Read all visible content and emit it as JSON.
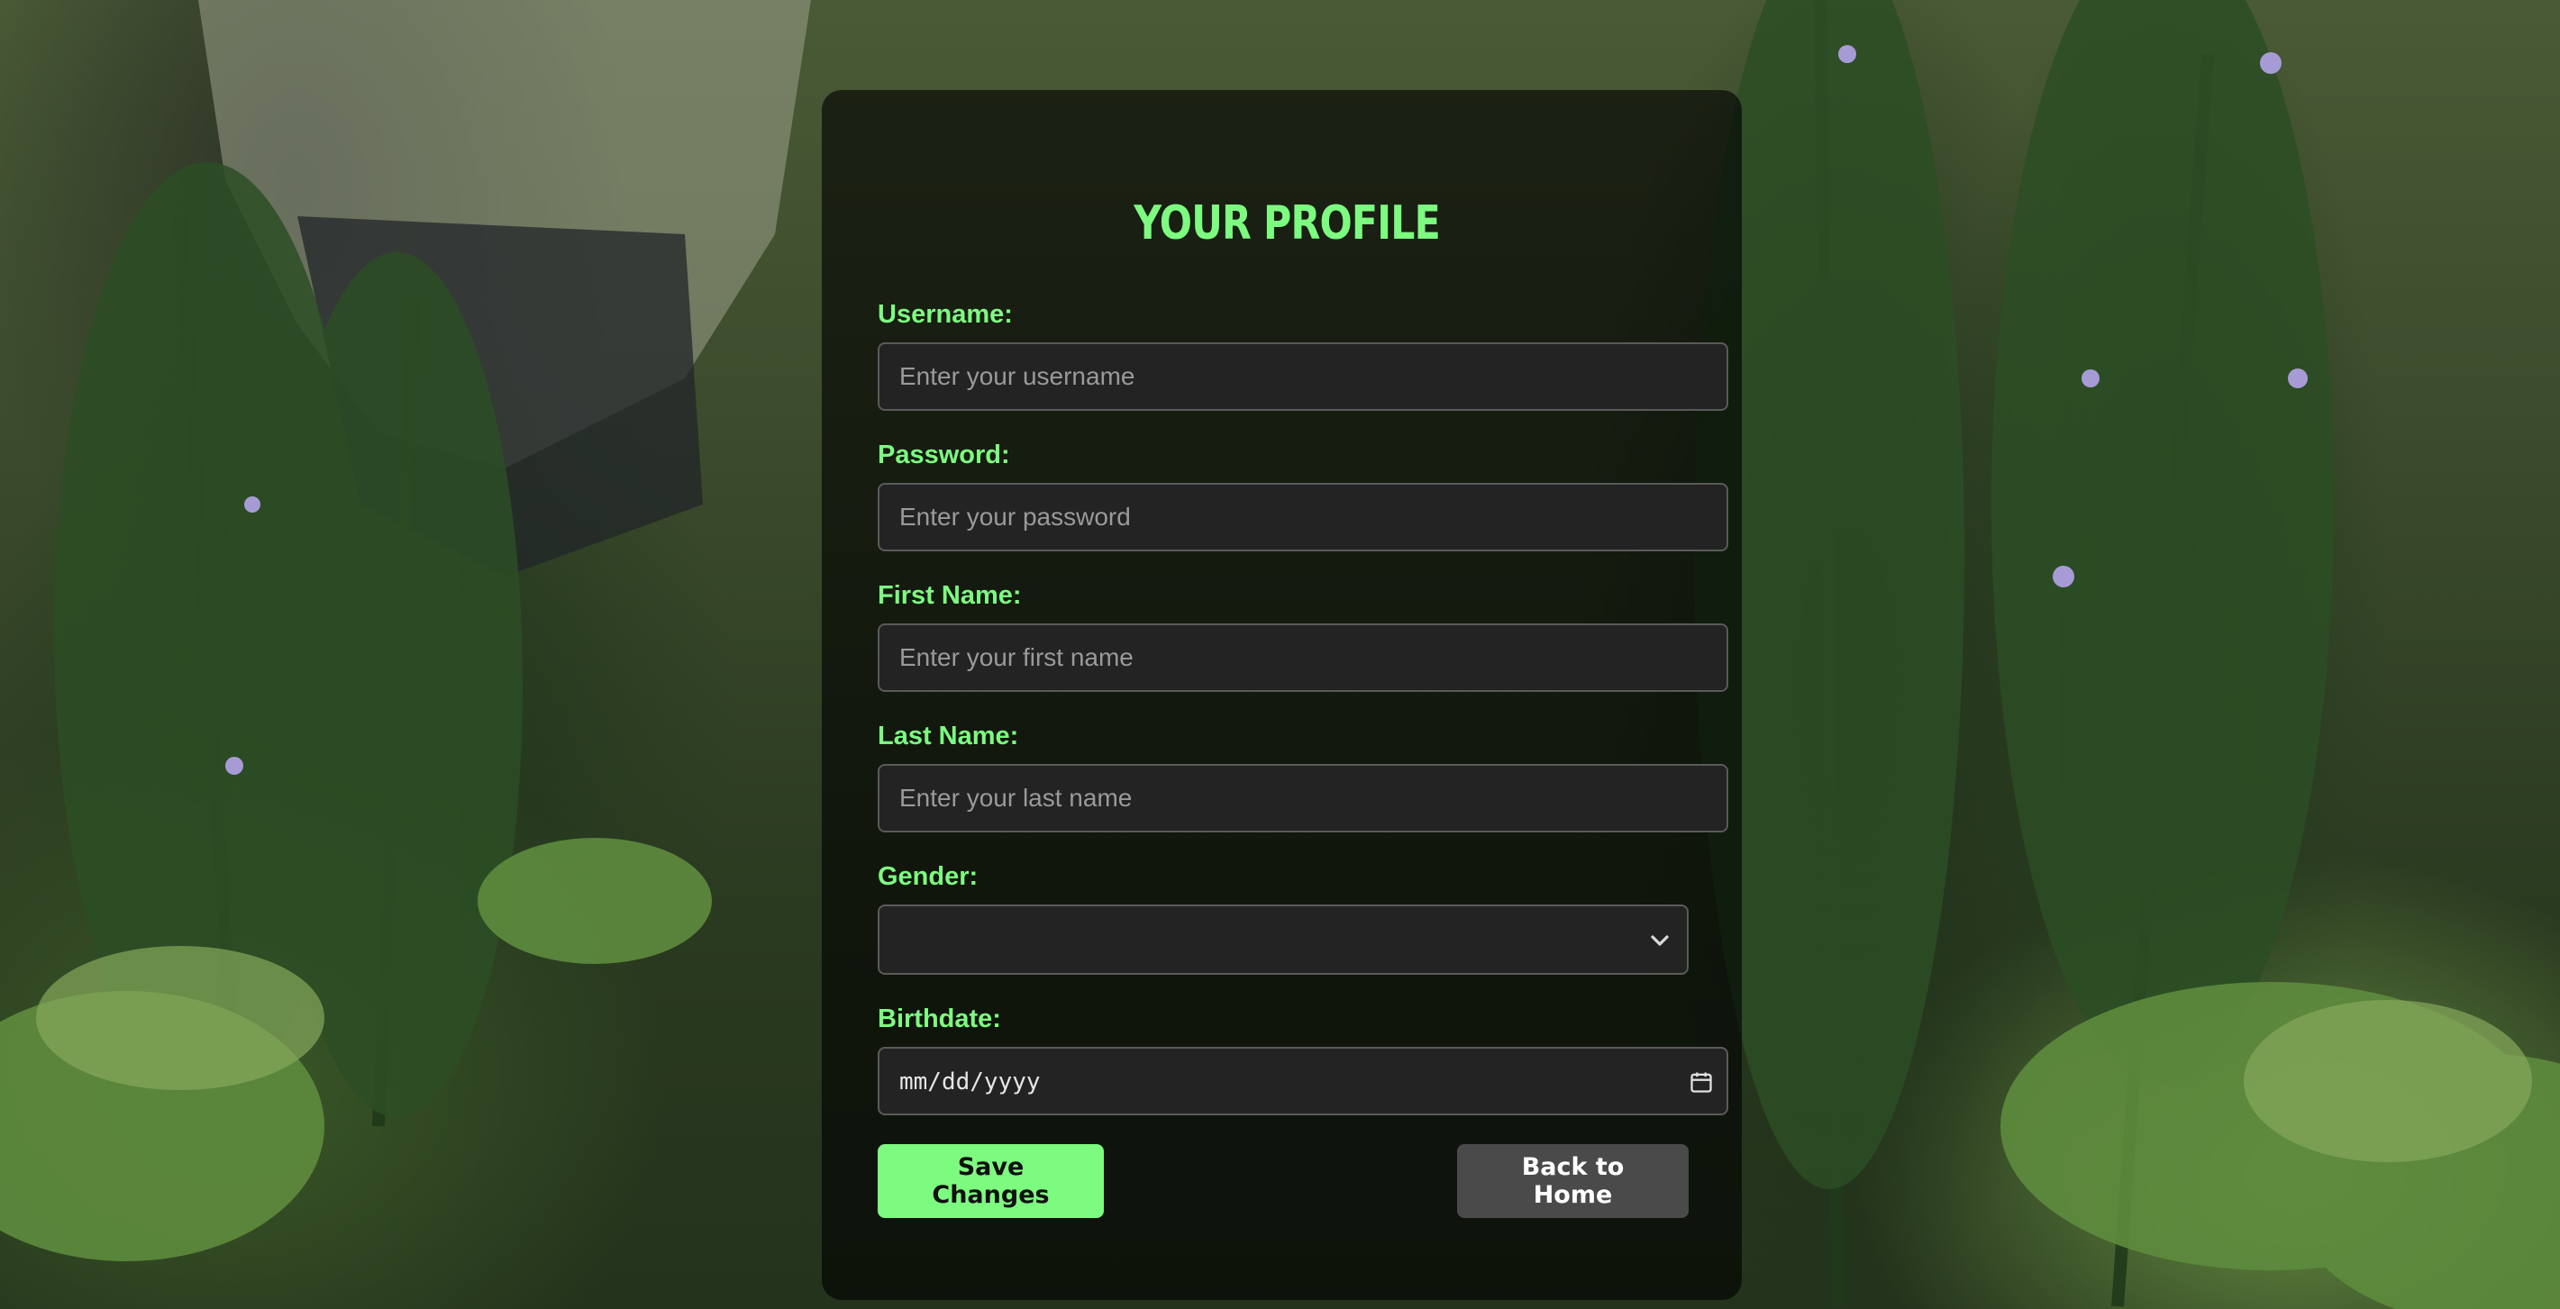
{
  "page": {
    "title": "YOUR PROFILE"
  },
  "form": {
    "username": {
      "label": "Username:",
      "placeholder": "Enter your username",
      "value": ""
    },
    "password": {
      "label": "Password:",
      "placeholder": "Enter your password",
      "value": ""
    },
    "first_name": {
      "label": "First Name:",
      "placeholder": "Enter your first name",
      "value": ""
    },
    "last_name": {
      "label": "Last Name:",
      "placeholder": "Enter your last name",
      "value": ""
    },
    "gender": {
      "label": "Gender:",
      "selected": ""
    },
    "birthdate": {
      "label": "Birthdate:",
      "display": "mm/dd/yyyy"
    }
  },
  "actions": {
    "save_label": "Save Changes",
    "home_label": "Back to Home"
  },
  "icons": {
    "gender_dropdown": "chevron-down-icon",
    "birthdate_picker": "calendar-icon"
  },
  "colors": {
    "accent": "#7dfa80",
    "card_bg": "rgba(0,0,0,0.62)",
    "input_bg": "#232323",
    "secondary_button": "#4a4a4a"
  }
}
